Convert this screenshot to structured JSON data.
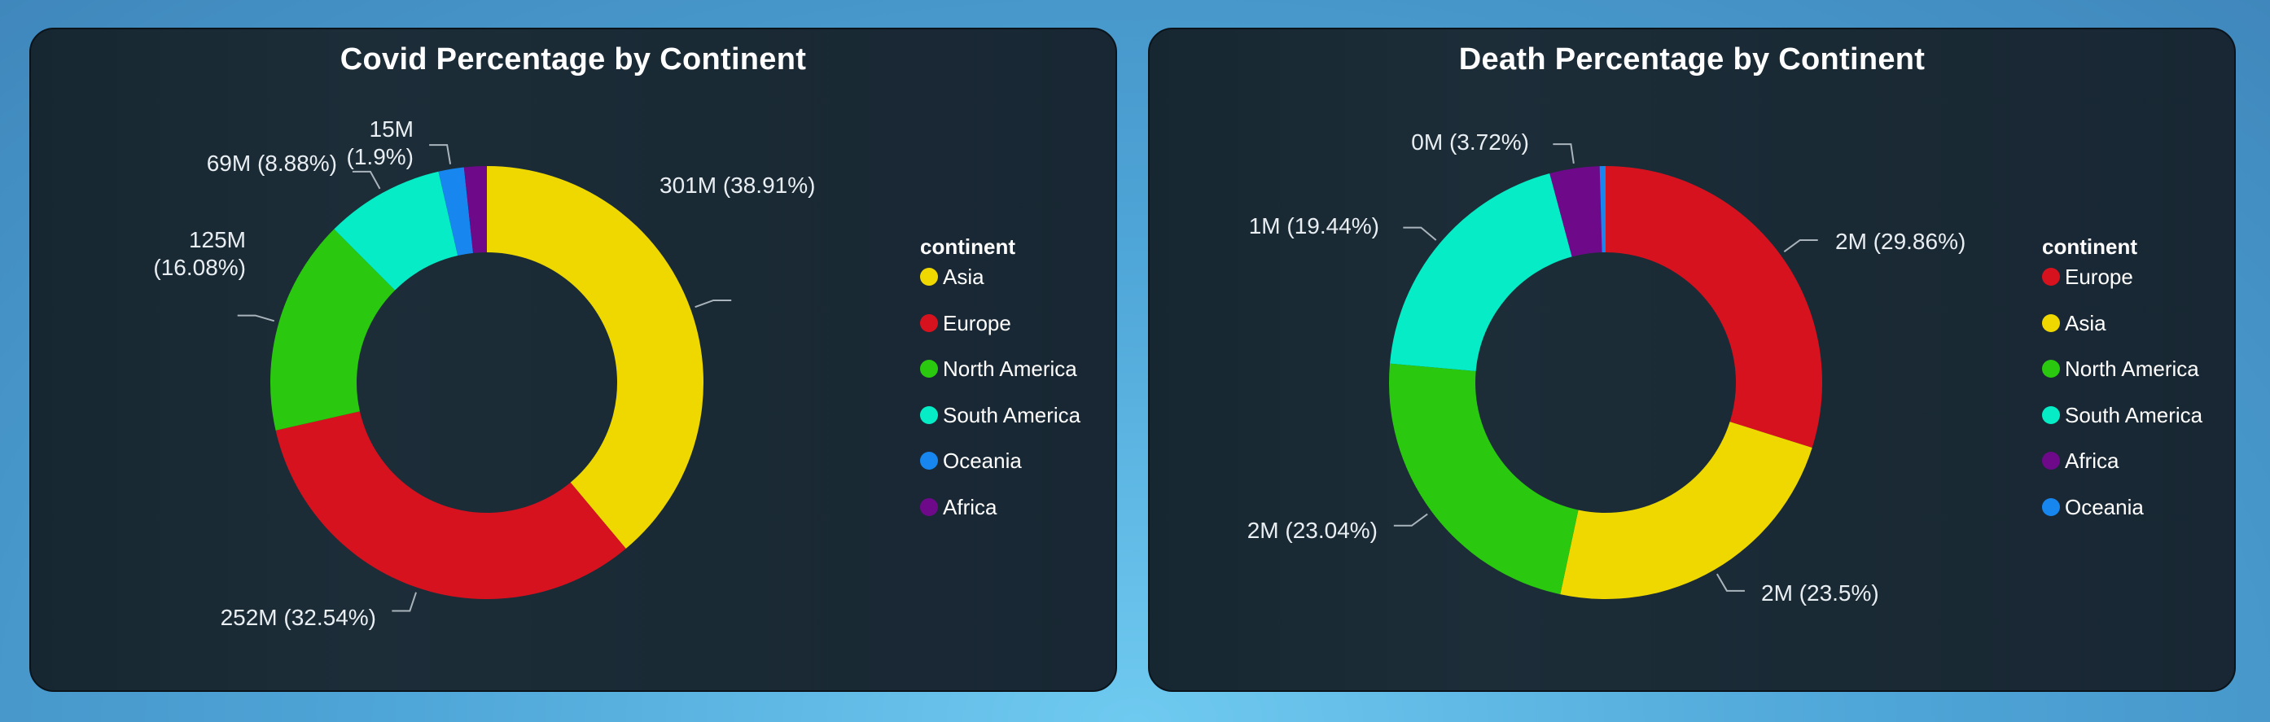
{
  "chart_data": [
    {
      "type": "pie",
      "title": "Covid Percentage by Continent",
      "legend_title": "continent",
      "legend_position": "right",
      "categories": [
        "Asia",
        "Europe",
        "North America",
        "South America",
        "Oceania",
        "Africa"
      ],
      "values": [
        38.91,
        32.54,
        16.08,
        8.88,
        1.9,
        1.69
      ],
      "colors": [
        "#efd800",
        "#d7121f",
        "#2ac80e",
        "#05ecc6",
        "#1786ee",
        "#6e0a8a"
      ],
      "data_labels": [
        "301M (38.91%)",
        "252M (32.54%)",
        "125M (16.08%)",
        "69M (8.88%)",
        "15M (1.9%)",
        ""
      ]
    },
    {
      "type": "pie",
      "title": "Death Percentage by Continent",
      "legend_title": "continent",
      "legend_position": "right",
      "categories": [
        "Europe",
        "Asia",
        "North America",
        "South America",
        "Africa",
        "Oceania"
      ],
      "values": [
        29.86,
        23.5,
        23.04,
        19.44,
        3.72,
        0.44
      ],
      "colors": [
        "#d7121f",
        "#efd800",
        "#2ac80e",
        "#05ecc6",
        "#6e0a8a",
        "#1786ee"
      ],
      "data_labels": [
        "2M (29.86%)",
        "2M (23.5%)",
        "2M (23.04%)",
        "1M (19.44%)",
        "0M (3.72%)",
        ""
      ]
    }
  ]
}
